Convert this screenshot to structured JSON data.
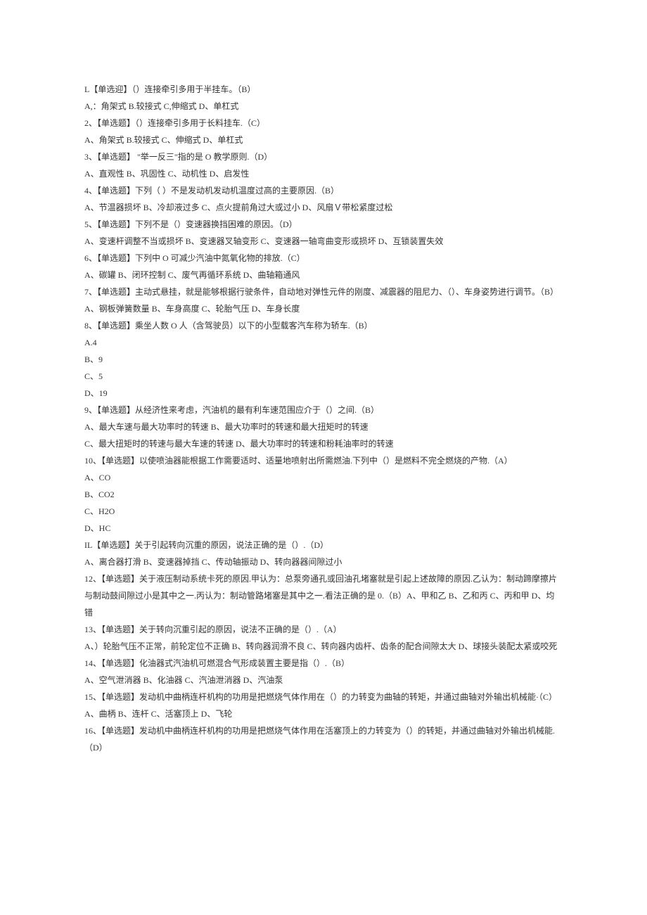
{
  "lines": [
    "L【单选迎】（）连接牵引多用于半挂车。（B）",
    "A,：角架式 B.较接式 C,伸缩式 D、单杠式",
    "2、【单选题】（）连接牵引多用于长料挂车.（C）",
    "A、角架式 B.较接式 C、伸缩式 D、单杠式",
    "3、【单选题】 \"举一反三\"指的是 O 教学原则.（D）",
    "A、直观性 B、巩固性 C、动机性 D、启发性",
    "4、【单选题】下列（ ）不是发动机发动机温度过高的主要原因.（B）",
    "A、节温器损坏 B、冷却液过多 C、点火提前角过大或过小 D、风扇Ｖ带松紧度过松",
    "5、【单选题】下列不是（）变速器换挡困难的原因。（D）",
    "A、变速杆调整不当或损坏 B、变速器叉轴变形 C、变速器一轴弯曲变形或损坏 D、互锁装置失效",
    "6、【单选题】下列中 O 可减少汽油中氮氧化物的排放.（C）",
    "A、碳罐 B、闭环控制 C、废气再循环系统 D、曲轴箱通风",
    "7、【单选题】主动式悬挂，就是能够根据行驶条件，自动地对弹性元件的刚度、减震器的阻尼力、（）、车身姿势进行调节。（B）",
    "A、钢板弹簧数量 B、车身高度 C、轮胎气压 D、车身长度",
    "8、【单选题】乘坐人数 O 人（含驾驶员）以下的小型载客汽车称为轿车.（B）",
    "A.4",
    "B、9",
    "C、5",
    "D、19",
    "9、【单选题】从经济性来考虑，汽油机的最有利车速范围应介于（）之间.（B）",
    "A、最大车速与最大功率时的转速 B、最大功率时的转速和最大扭矩时的转速",
    "C、最大扭矩时的转速与最大车速的转速 D、最大功率时的转速和粉耗油率时的转速",
    "10、【单选题】以使喷油器能根据工作需要适时、适量地喷射出所需燃油.下列中（）是燃料不完全燃烧的产物.（A）",
    "A、CO",
    "B、CO2",
    "C、H2O",
    "D、HC",
    "IL【单选题】关于引起转向沉重的原因，说法正确的是（）.（D）",
    "A、离合器打滑 B、变速器掉挡 C、传动轴振动 D、转向器器间隙过小",
    "12、【单选题】关于液压制动系统卡死的原因.甲认为：总泵旁通孔或回油孔堵塞就是引起上述故障的原因.乙认为：制动蹄摩擦片与制动鼓间隙过小是其中之一.丙认为：制动管路堵塞是其中之一.看法正确的是 0.（B）A、甲和乙 B、乙和丙 C、丙和甲 D、均错",
    "13、【单选题】关于转向沉重引起的原因，说法不正确的是（）.（A）",
    "A、）轮胎气压不正常，前轮定位不正确 B、转向器润滑不良 C、转向器内齿杆、齿条的配合间隙太大 D、球接头装配太紧或咬死 14、【单选题】化油器式汽油机可燃混合气形成装置主要是指（）.（B）",
    "A、空气泄消器 B、化油器 C、汽油泄消器 D、汽油泵",
    "15、【单选题】发动机中曲柄连杆机构的功用是把燃烧气体作用在（）的力转变为曲轴的转矩，并通过曲轴对外输出机械能·（C）",
    "A、曲柄 B、连杆 C、活塞顶上 D、飞轮",
    "16、【单选题】发动机中曲柄连杆机构的功用是把燃烧气体作用在活塞顶上的力转变为（）的转矩，并通过曲轴对外输出机械能.（D）"
  ]
}
